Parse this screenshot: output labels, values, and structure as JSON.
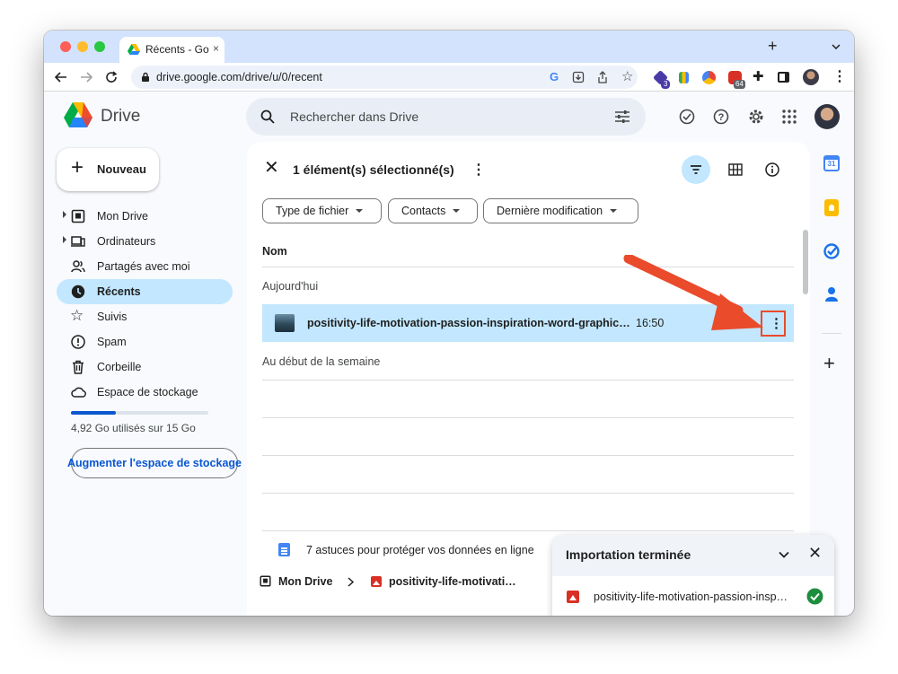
{
  "browser": {
    "tab_title": "Récents - Go",
    "url": "drive.google.com/drive/u/0/recent",
    "ext_badge_1": "3",
    "ext_badge_2": "64"
  },
  "app": {
    "name": "Drive",
    "search_placeholder": "Rechercher dans Drive"
  },
  "sidebar": {
    "new_button": "Nouveau",
    "items": [
      {
        "label": "Mon Drive"
      },
      {
        "label": "Ordinateurs"
      },
      {
        "label": "Partagés avec moi"
      },
      {
        "label": "Récents"
      },
      {
        "label": "Suivis"
      },
      {
        "label": "Spam"
      },
      {
        "label": "Corbeille"
      },
      {
        "label": "Espace de stockage"
      }
    ],
    "storage_text": "4,92 Go utilisés sur 15 Go",
    "storage_fraction": 0.328,
    "upgrade_button": "Augmenter l'espace de stockage"
  },
  "main": {
    "selection_text": "1 élément(s) sélectionné(s)",
    "filters": [
      "Type de fichier",
      "Contacts",
      "Dernière modification"
    ],
    "column_name": "Nom",
    "section_today": "Aujourd'hui",
    "section_week": "Au début de la semaine",
    "selected_file": {
      "name": "positivity-life-motivation-passion-inspiration-word-graphic…",
      "time": "16:50"
    },
    "partial_file": "7 astuces pour protéger vos données en ligne"
  },
  "breadcrumb": {
    "root": "Mon Drive",
    "file": "positivity-life-motivati…"
  },
  "upload_panel": {
    "title": "Importation terminée",
    "file": "positivity-life-motivation-passion-insp…"
  },
  "colors": {
    "accent_blue": "#0b57d0",
    "selected_bg": "#c2e7ff",
    "annotation_red": "#ea4b2b"
  }
}
